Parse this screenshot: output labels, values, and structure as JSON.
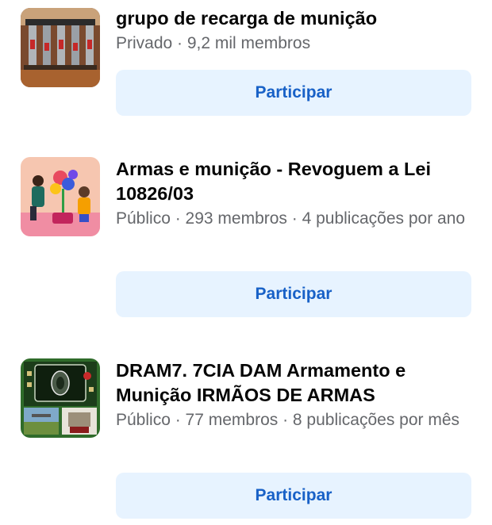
{
  "groups": [
    {
      "name": "grupo de recarga de munição",
      "meta": "Privado · 9,2 mil membros",
      "thumbnail_icon": "ammo-reloading-image",
      "join_label": "Participar"
    },
    {
      "name": "Armas e munição - Revoguem a Lei 10826/03",
      "meta": "Público · 293 membros · 4 publicações por ano",
      "thumbnail_icon": "illustration-people-flowers-image",
      "join_label": "Participar"
    },
    {
      "name": "DRAM7. 7CIA DAM Armamento e Munição IRMÃOS DE ARMAS",
      "meta": "Público · 77 membros · 8 publicações por mês",
      "thumbnail_icon": "military-emblem-image",
      "join_label": "Participar"
    }
  ],
  "colors": {
    "button_bg": "#e7f3ff",
    "button_text": "#1861c7",
    "title_text": "#050505",
    "meta_text": "#65676b"
  }
}
